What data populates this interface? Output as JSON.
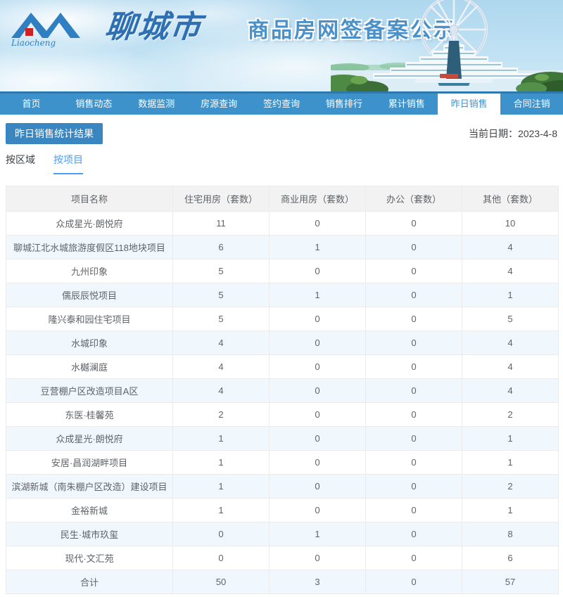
{
  "header": {
    "logo_script": "Liaocheng",
    "city_name": "聊城市",
    "site_subtitle": "商品房网签备案公示"
  },
  "nav": {
    "items": [
      {
        "label": "首页",
        "active": false
      },
      {
        "label": "销售动态",
        "active": false
      },
      {
        "label": "数据监测",
        "active": false
      },
      {
        "label": "房源查询",
        "active": false
      },
      {
        "label": "签约查询",
        "active": false
      },
      {
        "label": "销售排行",
        "active": false
      },
      {
        "label": "累计销售",
        "active": false
      },
      {
        "label": "昨日销售",
        "active": true
      },
      {
        "label": "合同注销",
        "active": false
      }
    ]
  },
  "page": {
    "section_title": "昨日销售统计结果",
    "current_date": "当前日期：2023-4-8",
    "tabs": [
      {
        "label": "按区域",
        "active": false
      },
      {
        "label": "按项目",
        "active": true
      }
    ]
  },
  "table": {
    "columns": [
      "项目名称",
      "住宅用房（套数）",
      "商业用房（套数）",
      "办公（套数）",
      "其他（套数）"
    ],
    "rows": [
      [
        "众成星光·朗悦府",
        "11",
        "0",
        "0",
        "10"
      ],
      [
        "聊城江北水城旅游度假区118地块项目",
        "6",
        "1",
        "0",
        "4"
      ],
      [
        "九州印象",
        "5",
        "0",
        "0",
        "4"
      ],
      [
        "儒辰辰悦项目",
        "5",
        "1",
        "0",
        "1"
      ],
      [
        "隆兴泰和园住宅项目",
        "5",
        "0",
        "0",
        "5"
      ],
      [
        "水城印象",
        "4",
        "0",
        "0",
        "4"
      ],
      [
        "水樾澜庭",
        "4",
        "0",
        "0",
        "4"
      ],
      [
        "豆营棚户区改造项目A区",
        "4",
        "0",
        "0",
        "4"
      ],
      [
        "东医·桂馨苑",
        "2",
        "0",
        "0",
        "2"
      ],
      [
        "众成星光·朗悦府",
        "1",
        "0",
        "0",
        "1"
      ],
      [
        "安居·昌润湖畔项目",
        "1",
        "0",
        "0",
        "1"
      ],
      [
        "滨湖新城（南朱棚户区改造）建设项目",
        "1",
        "0",
        "0",
        "2"
      ],
      [
        "金裕新城",
        "1",
        "0",
        "0",
        "1"
      ],
      [
        "民生·城市玖玺",
        "0",
        "1",
        "0",
        "8"
      ],
      [
        "现代·文汇苑",
        "0",
        "0",
        "0",
        "6"
      ],
      [
        "合计",
        "50",
        "3",
        "0",
        "57"
      ]
    ]
  },
  "colors": {
    "nav_blue": "#3e92cb",
    "nav_dark_edge": "#2d78ae",
    "badge_blue": "#3a86c0",
    "tab_active_blue": "#4a9ef2",
    "table_header_bg": "#f2f2f2",
    "row_alt_bg": "#f0f7fd",
    "table_border": "#ebebeb",
    "table_text": "#5f6368",
    "brand_blue": "#4a90c9",
    "logo_red": "#cc2222"
  }
}
